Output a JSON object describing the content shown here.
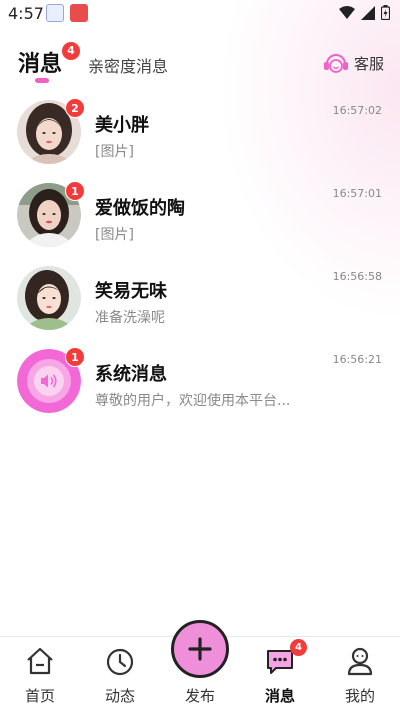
{
  "status_bar": {
    "time": "4:57"
  },
  "tabs": {
    "active_label": "消息",
    "active_badge": "4",
    "inactive_label": "亲密度消息"
  },
  "service": {
    "label": "客服",
    "icon": "headset-icon"
  },
  "messages": [
    {
      "name": "美小胖",
      "preview": "[图片]",
      "time": "16:57:02",
      "badge": "2"
    },
    {
      "name": "爱做饭的陶",
      "preview": "[图片]",
      "time": "16:57:01",
      "badge": "1"
    },
    {
      "name": "笑易无味",
      "preview": "准备洗澡呢",
      "time": "16:56:58",
      "badge": ""
    },
    {
      "name": "系统消息",
      "preview": "尊敬的用户，欢迎使用本平台...",
      "time": "16:56:21",
      "badge": "1"
    }
  ],
  "bottom_nav": {
    "items": [
      {
        "label": "首页",
        "icon": "home-icon"
      },
      {
        "label": "动态",
        "icon": "clock-icon"
      },
      {
        "label": "发布",
        "icon": "plus-icon"
      },
      {
        "label": "消息",
        "icon": "chat-icon",
        "badge": "4"
      },
      {
        "label": "我的",
        "icon": "person-icon"
      }
    ]
  },
  "colors": {
    "accent": "#ef62c6",
    "badge": "#f43b3b",
    "system_avatar": "#f168d6"
  }
}
